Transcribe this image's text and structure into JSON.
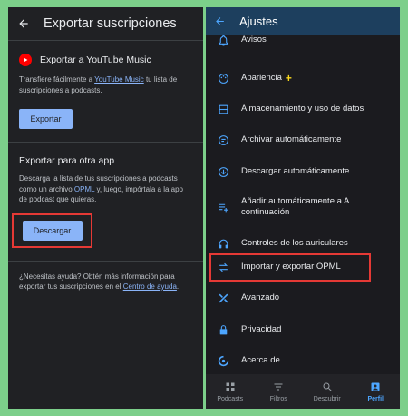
{
  "left": {
    "title": "Exportar suscripciones",
    "youtube": {
      "name": "Exportar a YouTube Music",
      "desc_before": "Transfiere fácilmente a ",
      "desc_link": "YouTube Music",
      "desc_after": " tu lista de suscripciones a podcasts.",
      "button": "Exportar"
    },
    "other": {
      "title": "Exportar para otra app",
      "desc_before": "Descarga la lista de tus suscripciones a podcasts como un archivo ",
      "desc_link": "OPML",
      "desc_after": " y, luego, impórtala a la app de podcast que quieras.",
      "button": "Descargar"
    },
    "help": {
      "before": "¿Necesitas ayuda? Obtén más información para exportar tus suscripciones en el ",
      "link": "Centro de ayuda",
      "after": "."
    }
  },
  "right": {
    "title": "Ajustes",
    "items": [
      {
        "label": "Avisos",
        "icon": "bell-icon"
      },
      {
        "label": "Apariencia",
        "icon": "palette-icon",
        "badge": "+"
      },
      {
        "label": "Almacenamiento y uso de datos",
        "icon": "storage-icon"
      },
      {
        "label": "Archivar automáticamente",
        "icon": "archive-icon"
      },
      {
        "label": "Descargar automáticamente",
        "icon": "download-icon"
      },
      {
        "label": "Añadir automáticamente a A continuación",
        "icon": "playlist-add-icon"
      },
      {
        "label": "Controles de los auriculares",
        "icon": "headphones-icon"
      },
      {
        "label": "Importar y exportar OPML",
        "icon": "swap-icon"
      },
      {
        "label": "Avanzado",
        "icon": "tools-icon"
      },
      {
        "label": "Privacidad",
        "icon": "lock-icon"
      },
      {
        "label": "Acerca de",
        "icon": "info-icon"
      }
    ],
    "nav": [
      {
        "label": "Podcasts",
        "icon": "podcasts-icon"
      },
      {
        "label": "Filtros",
        "icon": "filter-icon"
      },
      {
        "label": "Descubrir",
        "icon": "search-icon"
      },
      {
        "label": "Perfil",
        "icon": "profile-icon",
        "active": true
      }
    ]
  },
  "colors": {
    "frame": "#7ccf8a",
    "left_bg": "#202124",
    "right_bg": "#1b1b1f",
    "header_bg": "#1d3f5e",
    "accent": "#8ab4f8",
    "highlight": "#e53935",
    "nav_active": "#4da6ff"
  }
}
